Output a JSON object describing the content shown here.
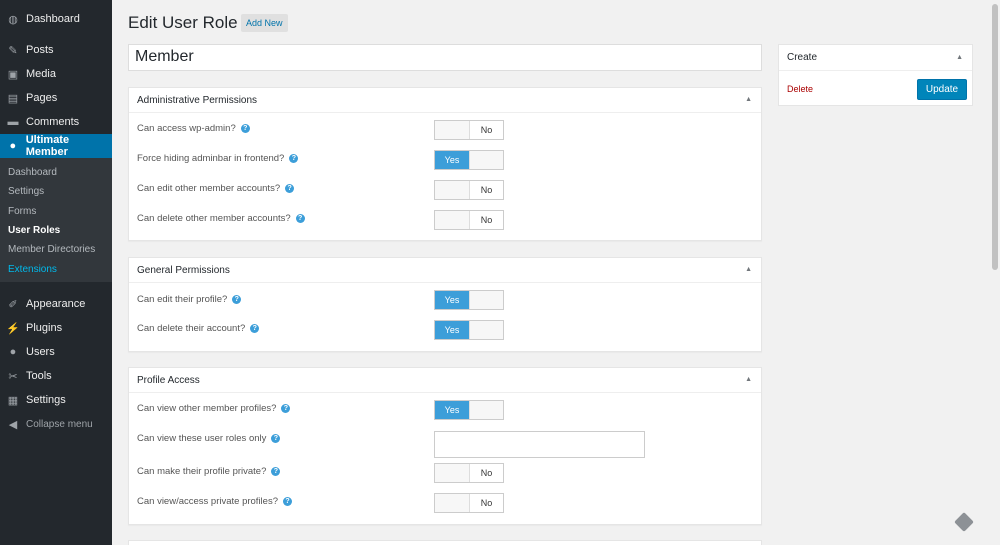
{
  "sidebar": {
    "menu": [
      {
        "label": "Dashboard",
        "icon": "dashboard-icon",
        "glyph": "◍"
      },
      {
        "label": "Posts",
        "icon": "pin-icon",
        "glyph": "✎"
      },
      {
        "label": "Media",
        "icon": "media-icon",
        "glyph": "▣"
      },
      {
        "label": "Pages",
        "icon": "pages-icon",
        "glyph": "▤"
      },
      {
        "label": "Comments",
        "icon": "comment-icon",
        "glyph": "▬"
      },
      {
        "label": "Ultimate Member",
        "icon": "user-icon",
        "glyph": "●"
      },
      {
        "label": "Appearance",
        "icon": "brush-icon",
        "glyph": "✐"
      },
      {
        "label": "Plugins",
        "icon": "plugin-icon",
        "glyph": "⚡"
      },
      {
        "label": "Users",
        "icon": "users-icon",
        "glyph": "●"
      },
      {
        "label": "Tools",
        "icon": "wrench-icon",
        "glyph": "✂"
      },
      {
        "label": "Settings",
        "icon": "settings-icon",
        "glyph": "▦"
      }
    ],
    "submenu": [
      "Dashboard",
      "Settings",
      "Forms",
      "User Roles",
      "Member Directories",
      "Extensions"
    ],
    "collapse": "Collapse menu"
  },
  "header": {
    "title": "Edit User Role",
    "add_new": "Add New"
  },
  "role_name": "Member",
  "panels": {
    "admin": {
      "title": "Administrative Permissions",
      "rows": [
        {
          "label": "Can access wp-admin?",
          "value": "No"
        },
        {
          "label": "Force hiding adminbar in frontend?",
          "value": "Yes"
        },
        {
          "label": "Can edit other member accounts?",
          "value": "No"
        },
        {
          "label": "Can delete other member accounts?",
          "value": "No"
        }
      ]
    },
    "general": {
      "title": "General Permissions",
      "rows": [
        {
          "label": "Can edit their profile?",
          "value": "Yes"
        },
        {
          "label": "Can delete their account?",
          "value": "Yes"
        }
      ]
    },
    "profile": {
      "title": "Profile Access",
      "rows": [
        {
          "label": "Can view other member profiles?",
          "value": "Yes"
        },
        {
          "label": "Can view these user roles only",
          "value": ""
        },
        {
          "label": "Can make their profile private?",
          "value": "No"
        },
        {
          "label": "Can view/access private profiles?",
          "value": "No"
        }
      ]
    }
  },
  "create_box": {
    "title": "Create",
    "delete": "Delete",
    "update": "Update"
  },
  "help_glyph": "?",
  "collapse_glyph": "▲",
  "colors": {
    "sidebar_bg": "#23282d",
    "active": "#0073aa",
    "toggle_on": "#3c9ed9",
    "delete": "#aa0000"
  }
}
